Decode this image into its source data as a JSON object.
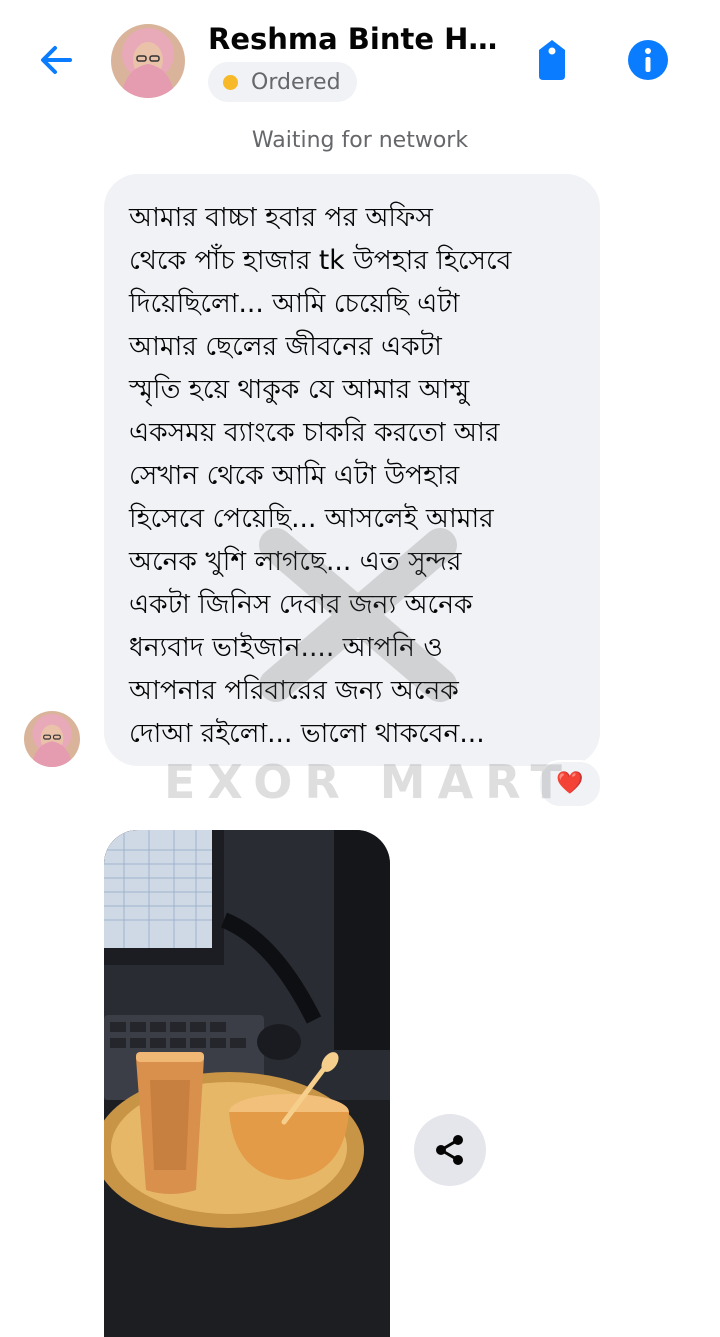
{
  "header": {
    "contact_name": "Reshma Binte Haki...",
    "status_label": "Ordered",
    "status_color": "#f7b928",
    "accent_color": "#0a7cff",
    "icons": {
      "back": "arrow-left-icon",
      "tag": "tag-icon",
      "info": "info-icon"
    }
  },
  "network_status": "Waiting for network",
  "message": {
    "text": "আমার বাচ্চা হবার পর অফিস\nথেকে পাঁচ হাজার tk উপহার হিসেবে\nদিয়েছিলো... আমি চেয়েছি এটা\nআমার ছেলের জীবনের একটা\nস্মৃতি হয়ে থাকুক যে আমার আম্মু\nএকসময় ব্যাংকে চাকরি করতো আর\nসেখান থেকে আমি এটা উপহার\nহিসেবে পেয়েছি... আসলেই আমার\nঅনেক খুশি লাগছে... এত সুন্দর\nএকটা জিনিস দেবার জন্য অনেক\nধন্যবাদ ভাইজান.... আপনি ও\nআপনার পরিবারের জন্য অনেক\nদোআ রইলো... ভালো থাকবেন...",
    "reaction": "❤️"
  },
  "watermark": {
    "text": "EXOR MART"
  },
  "photo": {
    "icon": "share-icon"
  }
}
